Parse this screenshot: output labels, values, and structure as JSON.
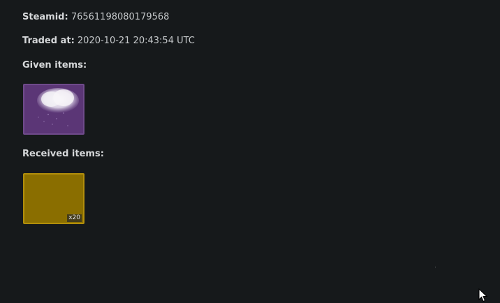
{
  "trade": {
    "steamid_label": "Steamid:",
    "steamid_value": "76561198080179568",
    "traded_at_label": "Traded at:",
    "traded_at_value": "2020-10-21 20:43:54 UTC"
  },
  "given": {
    "title": "Given items:",
    "items": [
      {
        "icon": "snow-cloud-icon",
        "color": "#5b3676"
      }
    ]
  },
  "received": {
    "title": "Received items:",
    "items": [
      {
        "icon": "gold-item-icon",
        "color": "#8a6e00",
        "quantity": "x20"
      }
    ]
  }
}
